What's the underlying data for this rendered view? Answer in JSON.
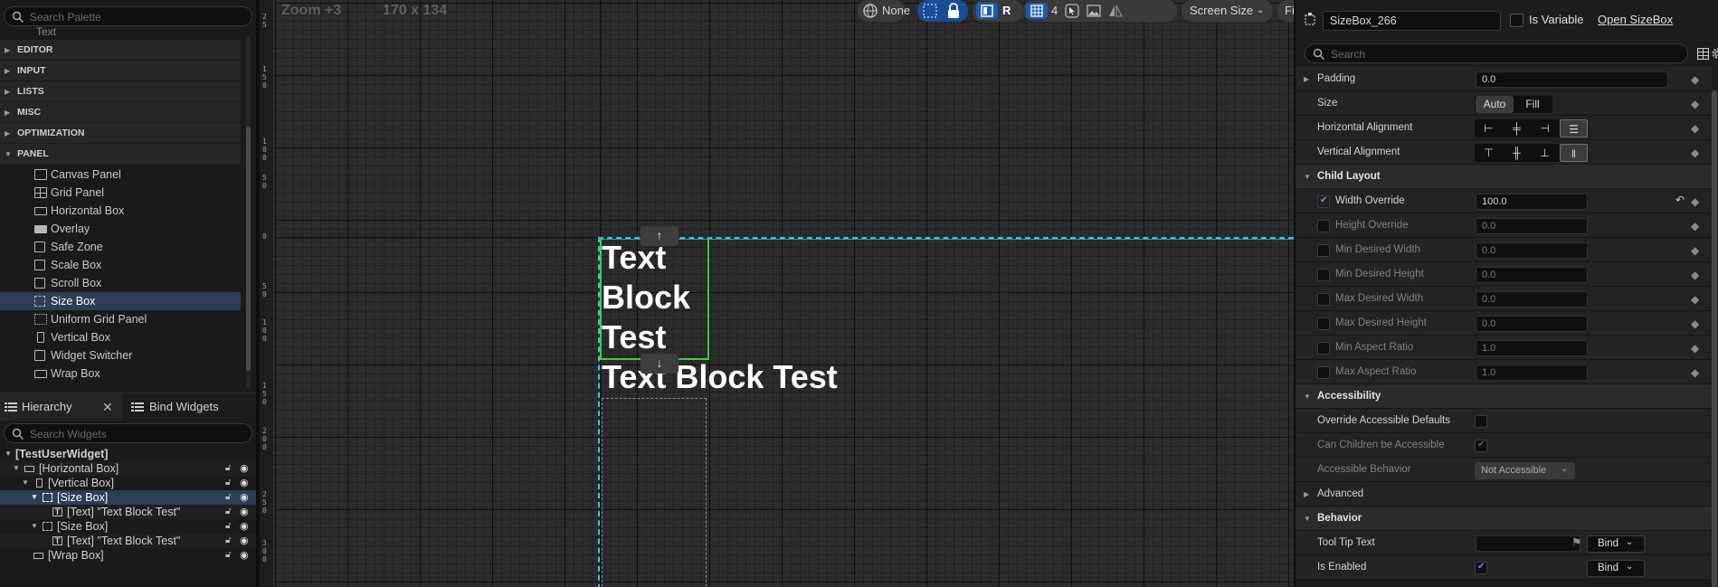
{
  "palette": {
    "search_placeholder": "Search Palette",
    "partial_item": "Text",
    "categories": [
      "EDITOR",
      "INPUT",
      "LISTS",
      "MISC",
      "OPTIMIZATION",
      "PANEL"
    ],
    "panel_items": [
      "Canvas Panel",
      "Grid Panel",
      "Horizontal Box",
      "Overlay",
      "Safe Zone",
      "Scale Box",
      "Scroll Box",
      "Size Box",
      "Uniform Grid Panel",
      "Vertical Box",
      "Widget Switcher",
      "Wrap Box"
    ],
    "selected_item": "Size Box"
  },
  "hierarchy": {
    "tab_label": "Hierarchy",
    "close_glyph": "✕",
    "bind_tab_label": "Bind Widgets",
    "search_placeholder": "Search Widgets",
    "tree": [
      {
        "label": "[TestUserWidget]"
      },
      {
        "label": "[Horizontal Box]"
      },
      {
        "label": "[Vertical Box]"
      },
      {
        "label": "[Size Box]"
      },
      {
        "label": "[Text] \"Text Block Test\""
      },
      {
        "label": "[Size Box]"
      },
      {
        "label": "[Text] \"Text Block Test\""
      },
      {
        "label": "[Wrap Box]"
      }
    ]
  },
  "designer": {
    "zoom": "Zoom +3",
    "resolution": "170 x 134",
    "location_label": "None",
    "layout_r": "R",
    "grid_snap": "4",
    "screen_size": "Screen Size",
    "fill_screen": "Fill Screen",
    "text_block_1": "Text Block Test",
    "text_block_2": "Text Block Test",
    "ruler_labels": [
      "2\n5",
      "1\n5\n0",
      "1\n0\n0",
      "5\n0",
      "0",
      "5\n0",
      "1\n0\n0",
      "1\n5\n0",
      "2\n0\n0",
      "2\n5\n0",
      "3\n0\n0"
    ],
    "arrow_up": "↑",
    "arrow_down": "↓"
  },
  "details": {
    "widget_name": "SizeBox_266",
    "is_variable_label": "Is Variable",
    "open_link": "Open SizeBox",
    "search_placeholder": "Search",
    "padding_label": "Padding",
    "padding_value": "0.0",
    "size_label": "Size",
    "size_auto": "Auto",
    "size_fill": "Fill",
    "halign_label": "Horizontal Alignment",
    "valign_label": "Vertical Alignment",
    "child_layout": "Child Layout",
    "fields": [
      {
        "label": "Width Override",
        "value": "100.0"
      },
      {
        "label": "Height Override",
        "value": "0.0"
      },
      {
        "label": "Min Desired Width",
        "value": "0.0"
      },
      {
        "label": "Min Desired Height",
        "value": "0.0"
      },
      {
        "label": "Max Desired Width",
        "value": "0.0"
      },
      {
        "label": "Max Desired Height",
        "value": "0.0"
      },
      {
        "label": "Min Aspect Ratio",
        "value": "1.0"
      },
      {
        "label": "Max Aspect Ratio",
        "value": "1.0"
      }
    ],
    "accessibility": "Accessibility",
    "override_accessible": "Override Accessible Defaults",
    "can_children_accessible": "Can Children be Accessible",
    "accessible_behavior": "Accessible Behavior",
    "accessible_behavior_value": "Not Accessible",
    "advanced": "Advanced",
    "behavior": "Behavior",
    "tooltip_label": "Tool Tip Text",
    "is_enabled_label": "Is Enabled",
    "bind_label": "Bind"
  },
  "colors": {
    "selection": "#2d3d55",
    "accent_blue": "#1e5bb0",
    "widget_outline": "#3fc4e6",
    "sizebox_outline": "#3ad13a"
  }
}
